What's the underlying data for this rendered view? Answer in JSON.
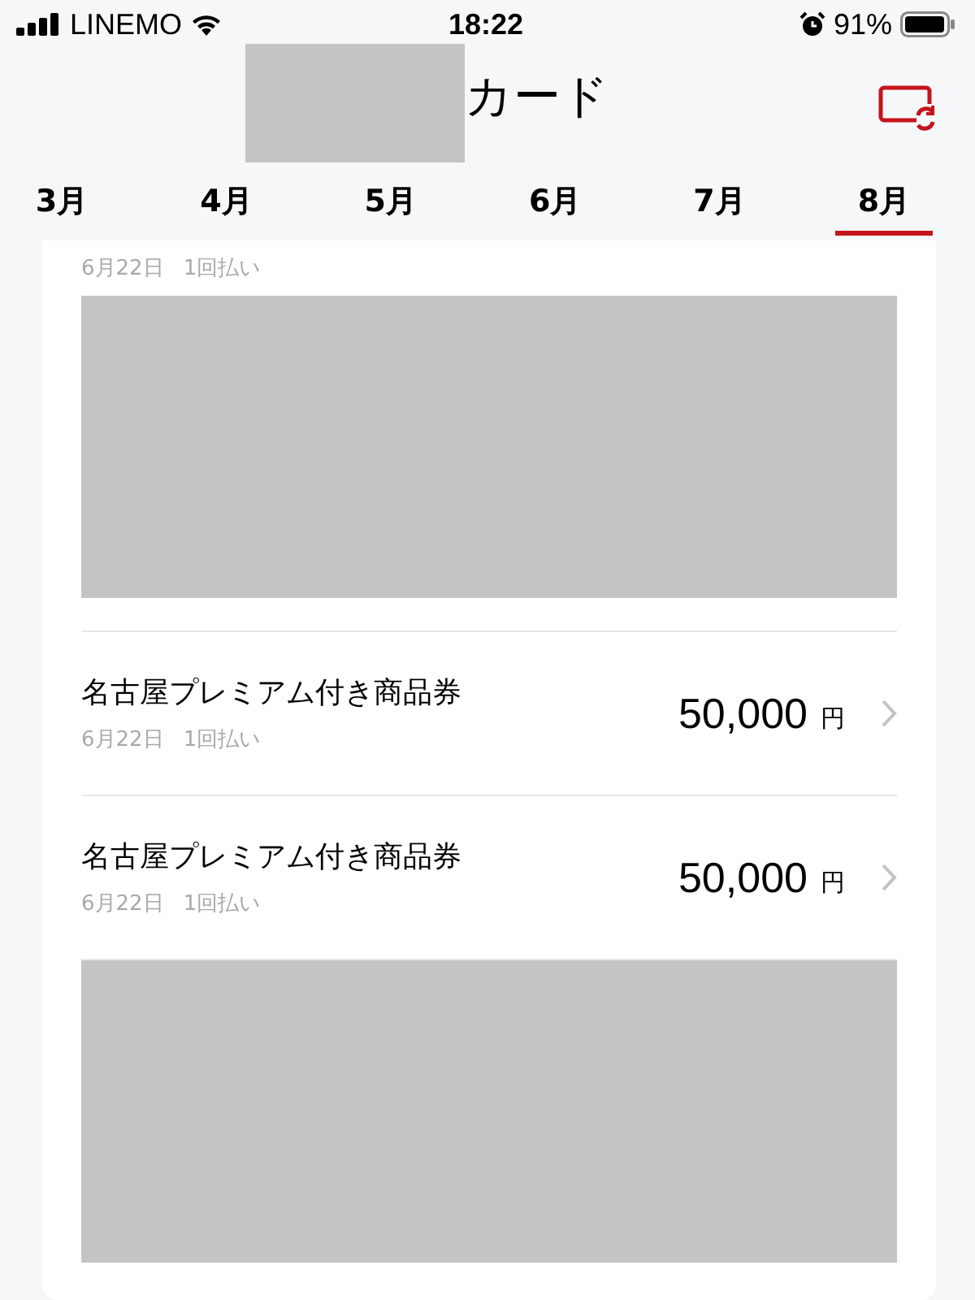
{
  "status_bar": {
    "carrier": "LINEMO",
    "time": "18:22",
    "battery": "91%"
  },
  "header": {
    "title": "カード"
  },
  "tabs": [
    {
      "label": "3月",
      "selected": false
    },
    {
      "label": "4月",
      "selected": false
    },
    {
      "label": "5月",
      "selected": false
    },
    {
      "label": "6月",
      "selected": false
    },
    {
      "label": "7月",
      "selected": false
    },
    {
      "label": "8月",
      "selected": true
    }
  ],
  "items": [
    {
      "kind": "transaction",
      "date": "6月22日",
      "payment": "1回払い"
    },
    {
      "kind": "redacted"
    },
    {
      "kind": "transaction",
      "title": "名古屋プレミアム付き商品券",
      "date": "6月22日",
      "payment": "1回払い",
      "amount": "50,000",
      "currency": "円"
    },
    {
      "kind": "transaction",
      "title": "名古屋プレミアム付き商品券",
      "date": "6月22日",
      "payment": "1回払い",
      "amount": "50,000",
      "currency": "円"
    },
    {
      "kind": "redacted"
    }
  ]
}
